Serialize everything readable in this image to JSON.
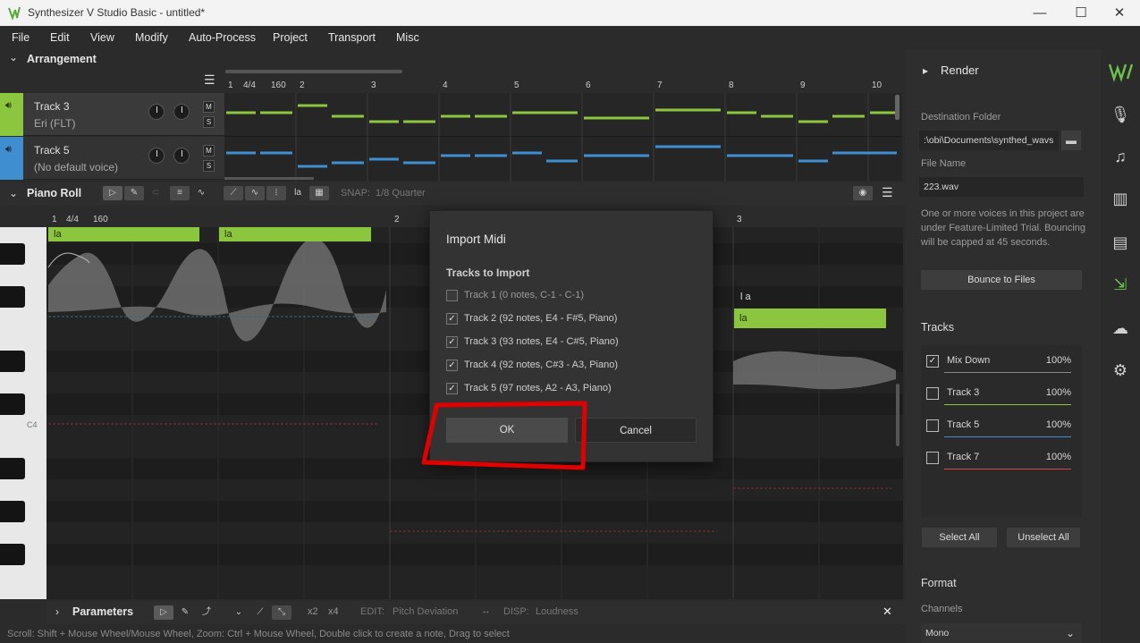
{
  "window": {
    "title": "Synthesizer V Studio Basic - untitled*",
    "minimize": "—",
    "maximize": "☐",
    "close": "✕"
  },
  "menu": [
    "File",
    "Edit",
    "View",
    "Modify",
    "Auto-Process",
    "Project",
    "Transport",
    "Misc"
  ],
  "arrangement": {
    "title": "Arrangement",
    "ruler": {
      "time_sig": "4/4",
      "tempo": "160",
      "bars": [
        "1",
        "2",
        "3",
        "4",
        "5",
        "6",
        "7",
        "8",
        "9",
        "10"
      ]
    },
    "tracks": [
      {
        "name": "Track 3",
        "voice": "Eri (FLT)",
        "color": "#8cc63f",
        "m": "M",
        "s": "S"
      },
      {
        "name": "Track 5",
        "voice": "(No default voice)",
        "color": "#3e8ed0",
        "m": "M",
        "s": "S"
      }
    ]
  },
  "piano_roll": {
    "title": "Piano Roll",
    "snap_label": "SNAP:",
    "snap_value": "1/8 Quarter",
    "ruler": {
      "time_sig": "4/4",
      "tempo": "160",
      "bars": [
        "1",
        "2",
        "3"
      ]
    },
    "key_label": "C4",
    "notes": [
      {
        "lyric": "la"
      },
      {
        "lyric": "la"
      },
      {
        "lyric": "la"
      }
    ],
    "phoneme": "l a"
  },
  "parameters": {
    "title": "Parameters",
    "edit_label": "EDIT:",
    "edit_value": "Pitch Deviation",
    "disp_label": "DISP:",
    "disp_value": "Loudness",
    "x2": "x2",
    "x4": "x4",
    "close": "✕"
  },
  "status": "Scroll: Shift + Mouse Wheel/Mouse Wheel, Zoom: Ctrl + Mouse Wheel, Double click to create a note, Drag to select",
  "dialog": {
    "title": "Import Midi",
    "subtitle": "Tracks to Import",
    "tracks": [
      {
        "label": "Track 1 (0 notes, C-1 - C-1)",
        "checked": false
      },
      {
        "label": "Track 2 (92 notes, E4 - F#5, Piano)",
        "checked": true
      },
      {
        "label": "Track 3 (93 notes, E4 - C#5, Piano)",
        "checked": true
      },
      {
        "label": "Track 4 (92 notes, C#3 - A3, Piano)",
        "checked": true
      },
      {
        "label": "Track 5 (97 notes, A2 - A3, Piano)",
        "checked": true
      }
    ],
    "ok": "OK",
    "cancel": "Cancel",
    "highlight_color": "#e00000"
  },
  "render": {
    "title": "Render",
    "dest_label": "Destination Folder",
    "dest_value": ":\\obi\\Documents\\synthed_wavs",
    "file_label": "File Name",
    "file_value": "223.wav",
    "notice": "One or more voices in this project are under Feature-Limited Trial. Bouncing will be capped at 45 seconds.",
    "bounce": "Bounce to Files",
    "tracks_title": "Tracks",
    "tracks": [
      {
        "name": "Mix Down",
        "pct": "100%",
        "checked": true,
        "color": "#888888"
      },
      {
        "name": "Track 3",
        "pct": "100%",
        "checked": false,
        "color": "#8cc63f"
      },
      {
        "name": "Track 5",
        "pct": "100%",
        "checked": false,
        "color": "#3e8ed0"
      },
      {
        "name": "Track 7",
        "pct": "100%",
        "checked": false,
        "color": "#d04848"
      }
    ],
    "select_all": "Select All",
    "unselect_all": "Unselect All",
    "format_title": "Format",
    "channels_label": "Channels",
    "channels_value": "Mono"
  },
  "sidebar_icons": [
    "logo-icon",
    "microphone-icon",
    "music-note-icon",
    "library-icon",
    "book-icon",
    "render-export-icon",
    "cloud-check-icon",
    "settings-gear-icon"
  ]
}
